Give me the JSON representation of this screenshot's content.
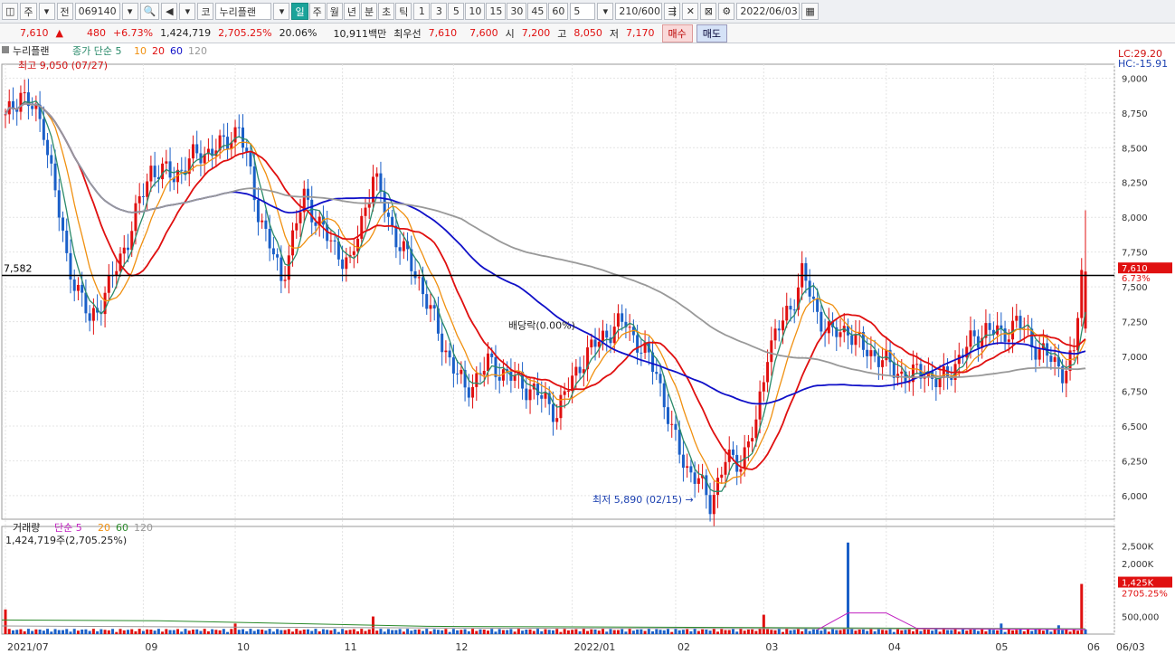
{
  "toolbar": {
    "chart_type": "주",
    "market": "전",
    "code": "069140",
    "market_tag": "코",
    "name": "누리플랜",
    "periods": [
      "일",
      "주",
      "월",
      "년",
      "분",
      "초",
      "틱"
    ],
    "active_period": "일",
    "intervals": [
      "1",
      "3",
      "5",
      "10",
      "15",
      "30",
      "45",
      "60"
    ],
    "interval_value": "5",
    "count": "210/600",
    "date": "2022/06/03"
  },
  "info": {
    "price": "7,610",
    "arrow": "▲",
    "change": "480",
    "change_pct": "+6.73%",
    "volume": "1,424,719",
    "volume_pct": "2,705.25%",
    "turnover": "20.06%",
    "amount": "10,911백만",
    "best_ask_label": "최우선",
    "best_ask": "7,610",
    "best_bid": "7,600",
    "open_label": "시",
    "open": "7,200",
    "high_label": "고",
    "high": "8,050",
    "low_label": "저",
    "low": "7,170",
    "buy_label": "매수",
    "sell_label": "매도"
  },
  "colors": {
    "up": "#e01010",
    "down": "#1a5fc8",
    "ma5": "#2a8a6a",
    "ma10": "#f09010",
    "ma20": "#e01010",
    "ma60": "#1010c8",
    "ma120": "#999999"
  },
  "chart_data": {
    "type": "candlestick",
    "price_panel": {
      "title": "누리플랜",
      "legend": [
        "종가 단순 5",
        "10",
        "20",
        "60",
        "120"
      ],
      "high_note": "최고 9,050 (07/27)",
      "low_note": "최저 5,890 (02/15)",
      "dividend_note": "배당락(0.00%)",
      "hline_label": "7,582",
      "hline_value": 7582,
      "current_label": "7,610",
      "current_pct": "6.73%",
      "lc_label": "LC:29.20",
      "hc_label": "HC:-15.91",
      "y_ticks": [
        "9,000",
        "8,750",
        "8,500",
        "8,250",
        "8,000",
        "7,750",
        "7,500",
        "7,250",
        "7,000",
        "6,750",
        "6,500",
        "6,250",
        "6,000"
      ],
      "y_values": [
        9000,
        8750,
        8500,
        8250,
        8000,
        7750,
        7500,
        7250,
        7000,
        6750,
        6500,
        6250,
        6000
      ],
      "ylim": [
        5830,
        9100
      ],
      "key_points": [
        {
          "i": 0,
          "close": 8700
        },
        {
          "i": 4,
          "close": 8900
        },
        {
          "i": 10,
          "close": 8650
        },
        {
          "i": 16,
          "close": 7700
        },
        {
          "i": 22,
          "close": 7250
        },
        {
          "i": 27,
          "close": 7500
        },
        {
          "i": 32,
          "close": 7850
        },
        {
          "i": 38,
          "close": 8350
        },
        {
          "i": 44,
          "close": 8300
        },
        {
          "i": 50,
          "close": 8450
        },
        {
          "i": 56,
          "close": 8500
        },
        {
          "i": 61,
          "close": 8650
        },
        {
          "i": 66,
          "close": 8050
        },
        {
          "i": 72,
          "close": 7550
        },
        {
          "i": 78,
          "close": 8150
        },
        {
          "i": 84,
          "close": 7850
        },
        {
          "i": 90,
          "close": 7650
        },
        {
          "i": 96,
          "close": 8300
        },
        {
          "i": 102,
          "close": 7850
        },
        {
          "i": 108,
          "close": 7550
        },
        {
          "i": 114,
          "close": 7100
        },
        {
          "i": 120,
          "close": 6750
        },
        {
          "i": 126,
          "close": 6950
        },
        {
          "i": 132,
          "close": 6850
        },
        {
          "i": 138,
          "close": 6750
        },
        {
          "i": 144,
          "close": 6600
        },
        {
          "i": 150,
          "close": 6950
        },
        {
          "i": 156,
          "close": 7150
        },
        {
          "i": 162,
          "close": 7250
        },
        {
          "i": 166,
          "close": 7050
        },
        {
          "i": 170,
          "close": 6900
        },
        {
          "i": 174,
          "close": 6450
        },
        {
          "i": 178,
          "close": 6200
        },
        {
          "i": 181,
          "close": 6100
        },
        {
          "i": 184,
          "close": 5950
        },
        {
          "i": 188,
          "close": 6250
        },
        {
          "i": 192,
          "close": 6250
        },
        {
          "i": 196,
          "close": 6500
        },
        {
          "i": 199,
          "close": 7050
        },
        {
          "i": 202,
          "close": 7200
        },
        {
          "i": 205,
          "close": 7350
        },
        {
          "i": 208,
          "close": 7600
        },
        {
          "i": 212,
          "close": 7300
        },
        {
          "i": 216,
          "close": 7150
        },
        {
          "i": 220,
          "close": 7200
        },
        {
          "i": 224,
          "close": 7050
        },
        {
          "i": 228,
          "close": 7000
        },
        {
          "i": 232,
          "close": 6900
        },
        {
          "i": 236,
          "close": 6850
        },
        {
          "i": 240,
          "close": 6900
        },
        {
          "i": 244,
          "close": 6800
        },
        {
          "i": 248,
          "close": 6950
        },
        {
          "i": 252,
          "close": 7100
        },
        {
          "i": 256,
          "close": 7200
        },
        {
          "i": 260,
          "close": 7150
        },
        {
          "i": 264,
          "close": 7250
        },
        {
          "i": 268,
          "close": 7100
        },
        {
          "i": 272,
          "close": 7000
        },
        {
          "i": 276,
          "close": 6900
        },
        {
          "i": 279,
          "close": 7000
        },
        {
          "i": 281,
          "close": 7610
        }
      ]
    },
    "volume_panel": {
      "title": "거래량",
      "legend": [
        "단순 5",
        "20",
        "60",
        "120"
      ],
      "value_note": "1,424,719주(2,705.25%)",
      "current_label": "1,425K",
      "current_pct": "2705.25%",
      "y_ticks": [
        "2,500K",
        "2,000K",
        "1,500K",
        "500,000"
      ],
      "y_values": [
        2500000,
        2000000,
        1500000,
        500000
      ],
      "ylim": [
        0,
        2800000
      ],
      "spikes": [
        {
          "i": 0,
          "v": 700000
        },
        {
          "i": 60,
          "v": 300000
        },
        {
          "i": 96,
          "v": 500000
        },
        {
          "i": 198,
          "v": 550000
        },
        {
          "i": 220,
          "v": 2600000
        },
        {
          "i": 260,
          "v": 300000
        },
        {
          "i": 275,
          "v": 250000
        },
        {
          "i": 281,
          "v": 1424719
        }
      ]
    },
    "x_tick_labels": [
      "2021/07",
      "09",
      "10",
      "11",
      "12",
      "2022/01",
      "02",
      "03",
      "04",
      "05",
      "06",
      "06/03"
    ],
    "x_tick_index": [
      0,
      36,
      60,
      88,
      117,
      148,
      175,
      198,
      230,
      258,
      282,
      300
    ]
  }
}
